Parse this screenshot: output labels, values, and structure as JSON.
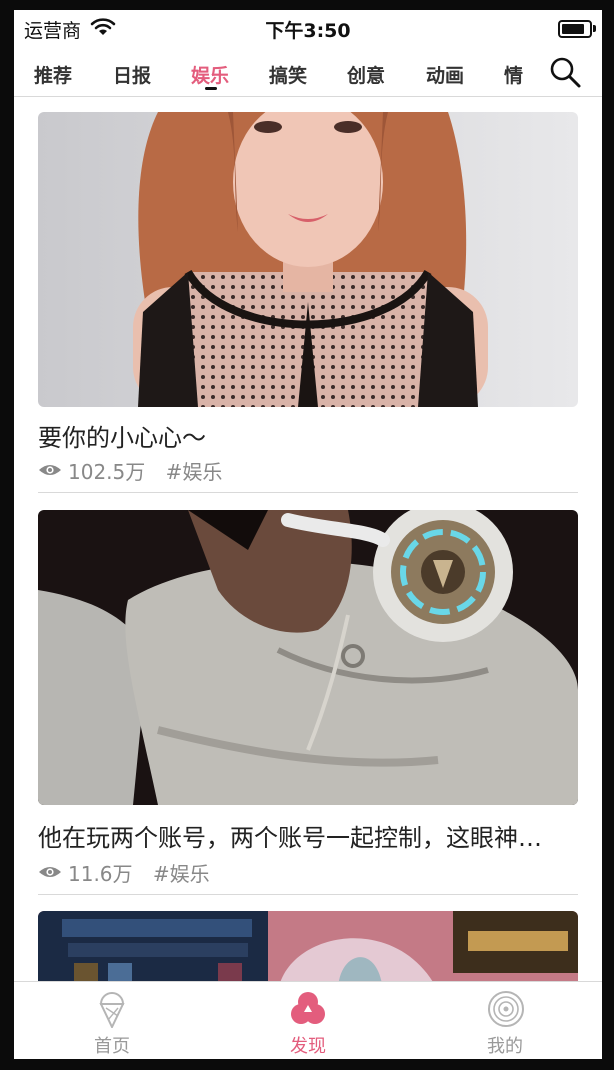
{
  "status_bar": {
    "carrier": "运营商",
    "time": "下午3:50"
  },
  "tabs": [
    {
      "label": "推荐"
    },
    {
      "label": "日报"
    },
    {
      "label": "娱乐"
    },
    {
      "label": "搞笑"
    },
    {
      "label": "创意"
    },
    {
      "label": "动画"
    },
    {
      "label": "情"
    }
  ],
  "active_tab": "娱乐",
  "feed": [
    {
      "title": "要你的小心心～",
      "views": "102.5万",
      "tag": "#娱乐"
    },
    {
      "title": "他在玩两个账号，两个账号一起控制，这眼神…",
      "views": "11.6万",
      "tag": "#娱乐"
    }
  ],
  "bottom_nav": [
    {
      "label": "首页",
      "icon": "ice-cream-icon"
    },
    {
      "label": "发现",
      "icon": "discover-icon"
    },
    {
      "label": "我的",
      "icon": "profile-icon"
    }
  ],
  "colors": {
    "accent": "#e35d7d",
    "inactive": "#999999",
    "text": "#222222",
    "divider": "#d9d9d9"
  }
}
